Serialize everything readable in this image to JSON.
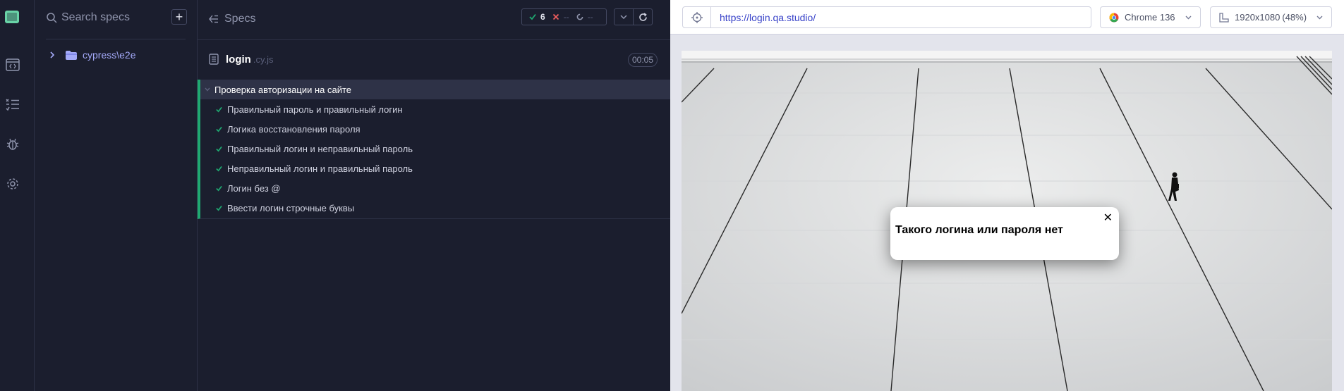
{
  "search": {
    "placeholder": "Search specs",
    "add_label": "+"
  },
  "tree": {
    "folder": "cypress\\e2e"
  },
  "reporter": {
    "header": "Specs",
    "stats": {
      "passed": "6",
      "failed": "--",
      "pending": "--"
    },
    "spec": {
      "name": "login",
      "ext": ".cy.js",
      "duration": "00:05"
    },
    "suite": {
      "title": "Проверка авторизации на сайте",
      "tests": [
        "Правильный пароль и правильный логин",
        "Логика восстановления пароля",
        "Правильный логин и неправильный пароль",
        "Неправильный логин и правильный пароль",
        "Логин без @",
        "Ввести логин строчные буквы"
      ]
    }
  },
  "browser": {
    "url": "https://login.qa.studio/",
    "name": "Chrome 136",
    "viewport": "1920x1080",
    "zoom": "(48%)"
  },
  "page": {
    "modal_message": "Такого логина или пароля нет",
    "modal_close": "✕"
  },
  "colors": {
    "pass": "#1fa971",
    "fail": "#f15e5e",
    "accent": "#a3a9f8",
    "link": "#3a44c9"
  }
}
